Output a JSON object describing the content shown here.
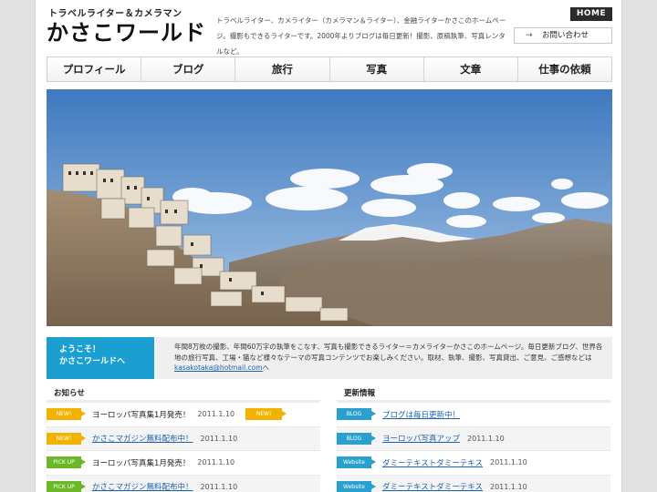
{
  "header": {
    "subtitle": "トラベルライター＆カメラマン",
    "title": "かさこワールド",
    "description": "トラベルライター、カメライター（カメラマン＆ライター）、金融ライターかさこのホームページ。撮影もできるライターです。2000年よりブログは毎日更新！撮影、原稿執筆、写真レンタルなど。",
    "home_label": "HOME",
    "contact_label": "お問い合わせ"
  },
  "nav": {
    "items": [
      {
        "label": "プロフィール"
      },
      {
        "label": "ブログ"
      },
      {
        "label": "旅行"
      },
      {
        "label": "写真"
      },
      {
        "label": "文章"
      },
      {
        "label": "仕事の依頼"
      }
    ]
  },
  "welcome": {
    "heading_line1": "ようこそ！",
    "heading_line2": "かさこワールドへ",
    "text": "年間8万枚の撮影、年間60万字の執筆をこなす、写真も撮影できるライター＝カメライターかさこのホームページ。毎日更新ブログ、世界各地の旅行写真、工場・猫など様々なテーマの写真コンテンツでお楽しみください。取材、執筆、撮影、写真貸出、ご意見、ご感想などは",
    "email": "kasakotaka@hotmail.com",
    "text_suffix": "へ"
  },
  "news": {
    "heading": "お知らせ",
    "items": [
      {
        "tag": "NEW!",
        "title": "ヨーロッパ写真集1月発売！",
        "date": "2011.1.10",
        "extra_tag": "NEW!"
      },
      {
        "tag": "NEW!",
        "title": "かさこマガジン無料配布中！",
        "date": "2011.1.10"
      },
      {
        "tag": "PICK UP",
        "title": "ヨーロッパ写真集1月発売！",
        "date": "2011.1.10"
      },
      {
        "tag": "PICK UP",
        "title": "かさこマガジン無料配布中！",
        "date": "2011.1.10"
      }
    ]
  },
  "updates": {
    "heading": "更新情報",
    "items": [
      {
        "tag": "BLOG",
        "title": "ブログは毎日更新中！",
        "date": ""
      },
      {
        "tag": "BLOG",
        "title": "ヨーロッパ写真アップ",
        "date": "2011.1.10"
      },
      {
        "tag": "Website",
        "title": "ダミーテキストダミーテキス",
        "date": "2011.1.10"
      },
      {
        "tag": "Website",
        "title": "ダミーテキストダミーテキス",
        "date": "2011.1.10"
      }
    ]
  },
  "colors": {
    "accent_blue": "#1a9fd0",
    "tag_new": "#f2b200",
    "tag_pickup": "#6ab828",
    "link": "#1d62b5"
  }
}
